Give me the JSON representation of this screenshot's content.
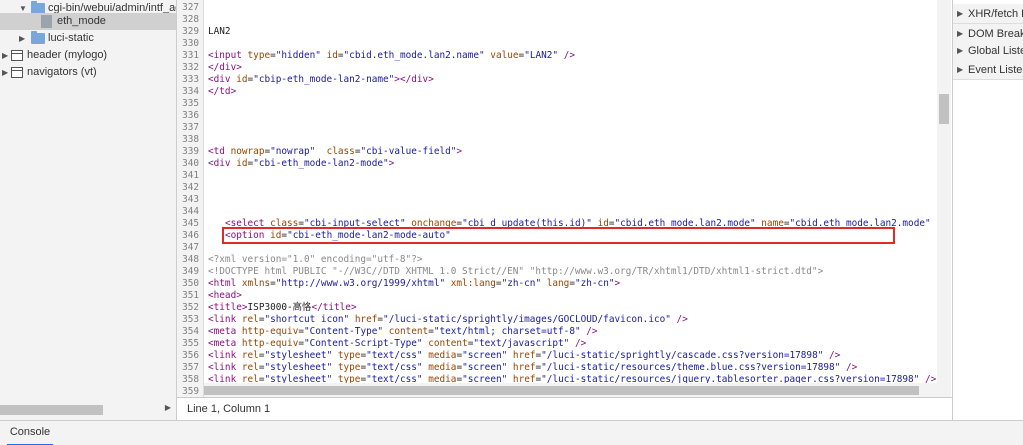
{
  "tree": {
    "items": [
      {
        "label": "cgi-bin/webui/admin/intf_ad",
        "kind": "folder",
        "expanded": true
      },
      {
        "label": "eth_mode",
        "kind": "file",
        "selected": true
      },
      {
        "label": "luci-static",
        "kind": "folder",
        "expanded": false
      },
      {
        "label": "header (mylogo)",
        "kind": "frame",
        "expanded": false
      },
      {
        "label": "navigators (vt)",
        "kind": "frame",
        "expanded": false
      }
    ]
  },
  "editor": {
    "lines": [
      {
        "n": "327",
        "t": ""
      },
      {
        "n": "328",
        "t": ""
      },
      {
        "n": "329",
        "t": "LAN2"
      },
      {
        "n": "330",
        "t": ""
      },
      {
        "n": "331",
        "t": "<input type=\"hidden\" id=\"cbid.eth_mode.lan2.name\" value=\"LAN2\" />"
      },
      {
        "n": "332",
        "t": "</div>"
      },
      {
        "n": "333",
        "t": "<div id=\"cbip-eth_mode-lan2-name\"></div>"
      },
      {
        "n": "334",
        "t": "</td>"
      },
      {
        "n": "335",
        "t": ""
      },
      {
        "n": "336",
        "t": ""
      },
      {
        "n": "337",
        "t": ""
      },
      {
        "n": "338",
        "t": ""
      },
      {
        "n": "339",
        "t": "<td nowrap=\"nowrap\"  class=\"cbi-value-field\">"
      },
      {
        "n": "340",
        "t": "<div id=\"cbi-eth_mode-lan2-mode\">"
      },
      {
        "n": "341",
        "t": ""
      },
      {
        "n": "342",
        "t": ""
      },
      {
        "n": "343",
        "t": ""
      },
      {
        "n": "344",
        "t": ""
      },
      {
        "n": "345",
        "t": "   <select class=\"cbi-input-select\" onchange=\"cbi_d_update(this.id)\" id=\"cbid.eth_mode.lan2.mode\" name=\"cbid.eth_mode.lan2.mode\""
      },
      {
        "n": "346",
        "t": "   <option id=\"cbi-eth_mode-lan2-mode-auto\""
      },
      {
        "n": "347",
        "t": ""
      },
      {
        "n": "348",
        "t": "<?xml version=\"1.0\" encoding=\"utf-8\"?>"
      },
      {
        "n": "349",
        "t": "<!DOCTYPE html PUBLIC \"-//W3C//DTD XHTML 1.0 Strict//EN\" \"http://www.w3.org/TR/xhtml1/DTD/xhtml1-strict.dtd\">"
      },
      {
        "n": "350",
        "t": "<html xmlns=\"http://www.w3.org/1999/xhtml\" xml:lang=\"zh-cn\" lang=\"zh-cn\">"
      },
      {
        "n": "351",
        "t": "<head>"
      },
      {
        "n": "352",
        "t": "<title>ISP3000-高恪</title>"
      },
      {
        "n": "353",
        "t": "<link rel=\"shortcut icon\" href=\"/luci-static/sprightly/images/GOCLOUD/favicon.ico\" />"
      },
      {
        "n": "354",
        "t": "<meta http-equiv=\"Content-Type\" content=\"text/html; charset=utf-8\" />"
      },
      {
        "n": "355",
        "t": "<meta http-equiv=\"Content-Script-Type\" content=\"text/javascript\" />"
      },
      {
        "n": "356",
        "t": "<link rel=\"stylesheet\" type=\"text/css\" media=\"screen\" href=\"/luci-static/sprightly/cascade.css?version=17898\" />"
      },
      {
        "n": "357",
        "t": "<link rel=\"stylesheet\" type=\"text/css\" media=\"screen\" href=\"/luci-static/resources/theme.blue.css?version=17898\" />"
      },
      {
        "n": "358",
        "t": "<link rel=\"stylesheet\" type=\"text/css\" media=\"screen\" href=\"/luci-static/resources/jquery.tablesorter.pager.css?version=17898\" />"
      },
      {
        "n": "359",
        "t": ""
      }
    ],
    "status": "Line 1, Column 1"
  },
  "right_panel": {
    "items": [
      "XHR/fetch Breakpoints",
      "DOM Breakpoints",
      "Global Listeners",
      "Event Listeners"
    ]
  },
  "drawer": {
    "tab": "Console"
  },
  "colors": {
    "highlight": "#e02a2a",
    "tag": "#881280",
    "attr": "#994500",
    "value": "#1a1aa6"
  }
}
